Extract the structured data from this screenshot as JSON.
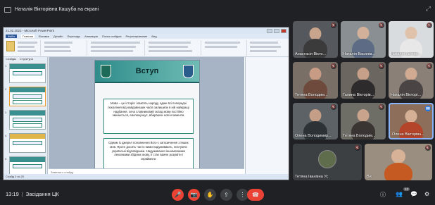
{
  "banner": {
    "presenter": "Наталія Вікторівна Кашуба на екрані"
  },
  "ppt": {
    "window_title": "21.02.2022 - Microsoft PowerPoint",
    "ribbon_tabs": [
      "Файл",
      "Главная",
      "Вставка",
      "Дизайн",
      "Переходы",
      "Анимация",
      "Показ слайдов",
      "Рецензирование",
      "Вид"
    ],
    "thumb_tabs": [
      "Слайды",
      "Структура"
    ],
    "slide": {
      "title": "Вступ",
      "box1": "Мова – це історія і пам'ять народу, адже всі попередні покоління від найдавніших часів залишили в ній найкращі надбання, хоча словниковий склад мови постійно змінюється, еволюціонує, вбираючи нові елементи.",
      "box2": "Одним із джерел поповнення його є запозичення з інших мов. Проте досить часто ними надуживають, нехтуючи українські відповідники. Надуживання іншомовними лексемами збіднює мову, її стає важче розуміти і сприймати."
    },
    "notes": "Заметки к слайду",
    "status": "Слайд 2 из 20"
  },
  "participants": [
    {
      "name": "Анастасія Вікто...",
      "mic": "off"
    },
    {
      "name": "Наталія Василів...",
      "mic": "off"
    },
    {
      "name": "Наталія Вікторі...",
      "mic": "off"
    },
    {
      "name": "Тетяна Володим...",
      "mic": "off"
    },
    {
      "name": "Галина Вікторів...",
      "mic": "off"
    },
    {
      "name": "Наталія Вікторі...",
      "mic": "off"
    },
    {
      "name": "Олена Володимир...",
      "mic": "off"
    },
    {
      "name": "Тетяна Володим...",
      "mic": "off"
    },
    {
      "name": "Олена Вікторівн...",
      "mic": "talk"
    },
    {
      "name": "Тетяна Іванівна Ус",
      "mic": "off"
    },
    {
      "name": "Ви",
      "mic": "off"
    }
  ],
  "bottombar": {
    "time": "13:19",
    "meeting": "Засідання ЦК",
    "people_count": "12"
  },
  "colors": {
    "bg": "#202124",
    "red": "#ea4335",
    "accent": "#8ab4f8",
    "slide_teal": "#2f8c8a"
  },
  "icons": [
    "mic-off-icon",
    "camera-off-icon",
    "hand-icon",
    "present-icon",
    "more-icon",
    "hangup-icon",
    "info-icon",
    "people-icon",
    "chat-icon",
    "activities-icon"
  ]
}
